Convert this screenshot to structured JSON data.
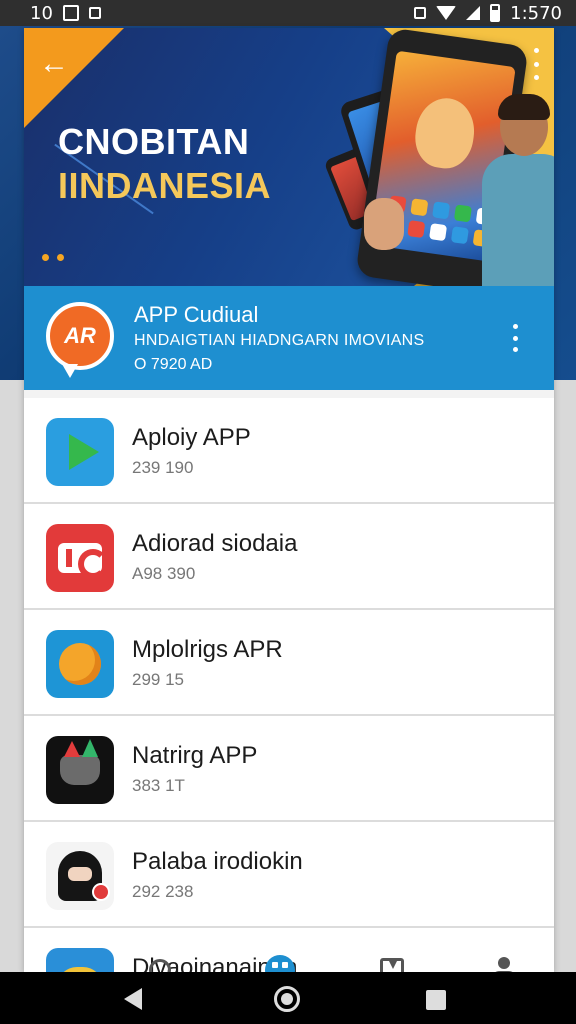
{
  "status_bar": {
    "left_text": "10",
    "time": "1:570"
  },
  "hero": {
    "title_line1": "CNOBITAN",
    "title_line2": "IINDANESIA",
    "back_icon": "arrow-left-icon",
    "menu_icon": "more-vert-icon"
  },
  "app": {
    "logo_text": "AR",
    "name": "APP Cudiual",
    "subtitle": "HNDAIGTIAN HIADNGARN IMOVIANS",
    "meta": "O 7920 AD",
    "menu_icon": "more-vert-icon"
  },
  "list": {
    "items": [
      {
        "title": "Aploiy APP",
        "sub": "239 190",
        "icon": "play-store-icon",
        "color": "#2a9ee0"
      },
      {
        "title": "Adiorad siodaia",
        "sub": "A98 390",
        "icon": "red-ic-icon",
        "color": "#e23a3a"
      },
      {
        "title": "Mplolrigs APR",
        "sub": "299 15",
        "icon": "yellow-fox-icon",
        "color": "#1e95d6"
      },
      {
        "title": "Natrirg APP",
        "sub": "383 1T",
        "icon": "dark-cat-icon",
        "color": "#111111"
      },
      {
        "title": "Palaba irodiokin",
        "sub": "292 238",
        "icon": "ninja-icon",
        "color": "#f4f4f4"
      },
      {
        "title": "Dlvaoinanainan",
        "sub": "",
        "icon": "yellow-sun-icon",
        "color": "#2a8fd8"
      }
    ]
  },
  "bottom_nav": {
    "items": [
      {
        "name": "search",
        "icon": "search-icon"
      },
      {
        "name": "home",
        "icon": "grid-icon"
      },
      {
        "name": "library",
        "icon": "book-icon"
      },
      {
        "name": "profile",
        "icon": "person-icon"
      }
    ]
  },
  "colors": {
    "accent": "#1e8fd0",
    "hero_dark": "#163f88",
    "orange": "#f06a25"
  }
}
